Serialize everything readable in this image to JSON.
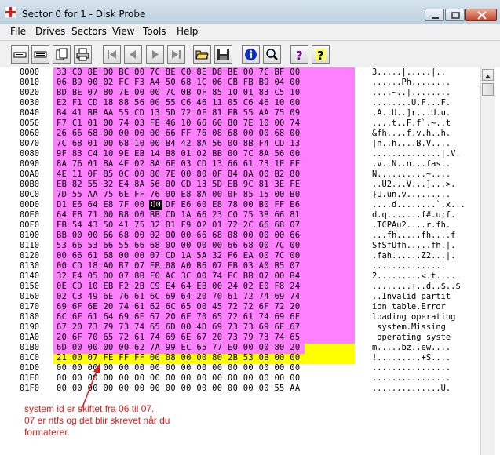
{
  "window": {
    "title": "Sector 0 for 1 - Disk Probe"
  },
  "menu": [
    "File",
    "Drives",
    "Sectors",
    "View",
    "Tools",
    "Help"
  ],
  "toolbar": {
    "buttons": [
      "drive-icon",
      "volume-icon",
      "pages-icon",
      "print-icon",
      "first-sector-icon",
      "previous-sector-icon",
      "next-sector-icon",
      "last-sector-icon",
      "open-folder-icon",
      "save-icon",
      "info-icon",
      "search-icon",
      "help-icon",
      "context-help-icon"
    ]
  },
  "hex": {
    "offsets": [
      "0000",
      "0010",
      "0020",
      "0030",
      "0040",
      "0050",
      "0060",
      "0070",
      "0080",
      "0090",
      "00A0",
      "00B0",
      "00C0",
      "00D0",
      "00E0",
      "00F0",
      "0100",
      "0110",
      "0120",
      "0130",
      "0140",
      "0150",
      "0160",
      "0170",
      "0180",
      "0190",
      "01A0",
      "01B0",
      "01C0",
      "01D0",
      "01E0",
      "01F0"
    ],
    "rows": [
      "33 C0 8E D0 BC 00 7C 8E C0 8E D8 BE 00 7C BF 00",
      "06 B9 00 02 FC F3 A4 50 68 1C 06 CB FB B9 04 00",
      "BD BE 07 80 7E 00 00 7C 0B 0F 85 10 01 83 C5 10",
      "E2 F1 CD 18 88 56 00 55 C6 46 11 05 C6 46 10 00",
      "B4 41 BB AA 55 CD 13 5D 72 0F 81 FB 55 AA 75 09",
      "F7 C1 01 00 74 03 FE 46 10 66 60 80 7E 10 00 74",
      "26 66 68 00 00 00 00 66 FF 76 08 68 00 00 68 00",
      "7C 68 01 00 68 10 00 B4 42 8A 56 00 8B F4 CD 13",
      "9F 83 C4 10 9E EB 14 B8 01 02 BB 00 7C 8A 56 00",
      "8A 76 01 8A 4E 02 8A 6E 03 CD 13 66 61 73 1E FE",
      "4E 11 0F 85 0C 00 80 7E 00 80 0F 84 8A 00 B2 80",
      "EB 82 55 32 E4 8A 56 00 CD 13 5D EB 9C 81 3E FE",
      "7D 55 AA 75 6E FF 76 00 E8 8A 00 0F 85 15 00 B0",
      "D1 E6 64 E8 7F 00 B0 DF E6 60 E8 78 00 B0 FF E6",
      "64 E8 71 00 B8 00 BB CD 1A 66 23 C0 75 3B 66 81",
      "FB 54 43 50 41 75 32 81 F9 02 01 72 2C 66 68 07",
      "BB 00 00 66 68 00 02 00 00 66 68 08 00 00 00 66",
      "53 66 53 66 55 66 68 00 00 00 00 66 68 00 7C 00",
      "00 66 61 68 00 00 07 CD 1A 5A 32 F6 EA 00 7C 00",
      "00 CD 18 A0 B7 07 EB 08 A0 B6 07 EB 03 A0 B5 07",
      "32 E4 05 00 07 8B F0 AC 3C 00 74 FC BB 07 00 B4",
      "0E CD 10 EB F2 2B C9 E4 64 EB 00 24 02 E0 F8 24",
      "02 C3 49 6E 76 61 6C 69 64 20 70 61 72 74 69 74",
      "69 6F 6E 20 74 61 62 6C 65 00 45 72 72 6F 72 20",
      "6C 6F 61 64 69 6E 67 20 6F 70 65 72 61 74 69 6E",
      "67 20 73 79 73 74 65 6D 00 4D 69 73 73 69 6E 67",
      "20 6F 70 65 72 61 74 69 6E 67 20 73 79 73 74 65",
      "6D 00 00 00 00 62 7A 99 EC 65 77 E0 00 00 80 20",
      "21 00 07 FE FF FF 00 08 00 00 80 2B 53 0B 00 00",
      "00 00 00 00 00 00 00 00 00 00 00 00 00 00 00 00",
      "00 00 00 00 00 00 00 00 00 00 00 00 00 00 00 00",
      "00 00 00 00 00 00 00 00 00 00 00 00 00 00 55 AA"
    ],
    "ascii": [
      "3.....|.....|..",
      "......Ph........",
      "....~..|........",
      "........U.F...F.",
      ".A..U..]r...U.u.",
      "....t..F.f`.~..t",
      "&fh....f.v.h..h.",
      "|h..h....B.V....",
      "..............|.V.",
      ".v..N..n...fas..",
      "N..........~....",
      "..U2...V...]...>.",
      "}U.un.v.........",
      "....d........`.x...",
      "d.q.......f#.u;f.",
      ".TCPAu2....r.fh.",
      "...fh.....fh....f",
      "SfSfUfh.....fh.|.",
      ".fah......Z2...|.",
      "...............",
      "2.........<.t.....",
      "........+..d..$..$",
      "..Invalid partit",
      "ion table.Error ",
      "loading operating",
      " system.Missing",
      " operating syste",
      "m.....bz..ew....",
      "!.........+S....",
      "................",
      "................",
      "..............U."
    ],
    "cursor_cell": "00"
  },
  "annotation": {
    "lines": [
      "system id er skiftet fra 06 til 07.",
      "07 er ntfs og det blir skrevet når du",
      "formaterer."
    ]
  },
  "colors": {
    "hex_highlight": "#ff80ff",
    "partition_highlight": "#ffff00",
    "annotation": "#d42020"
  }
}
